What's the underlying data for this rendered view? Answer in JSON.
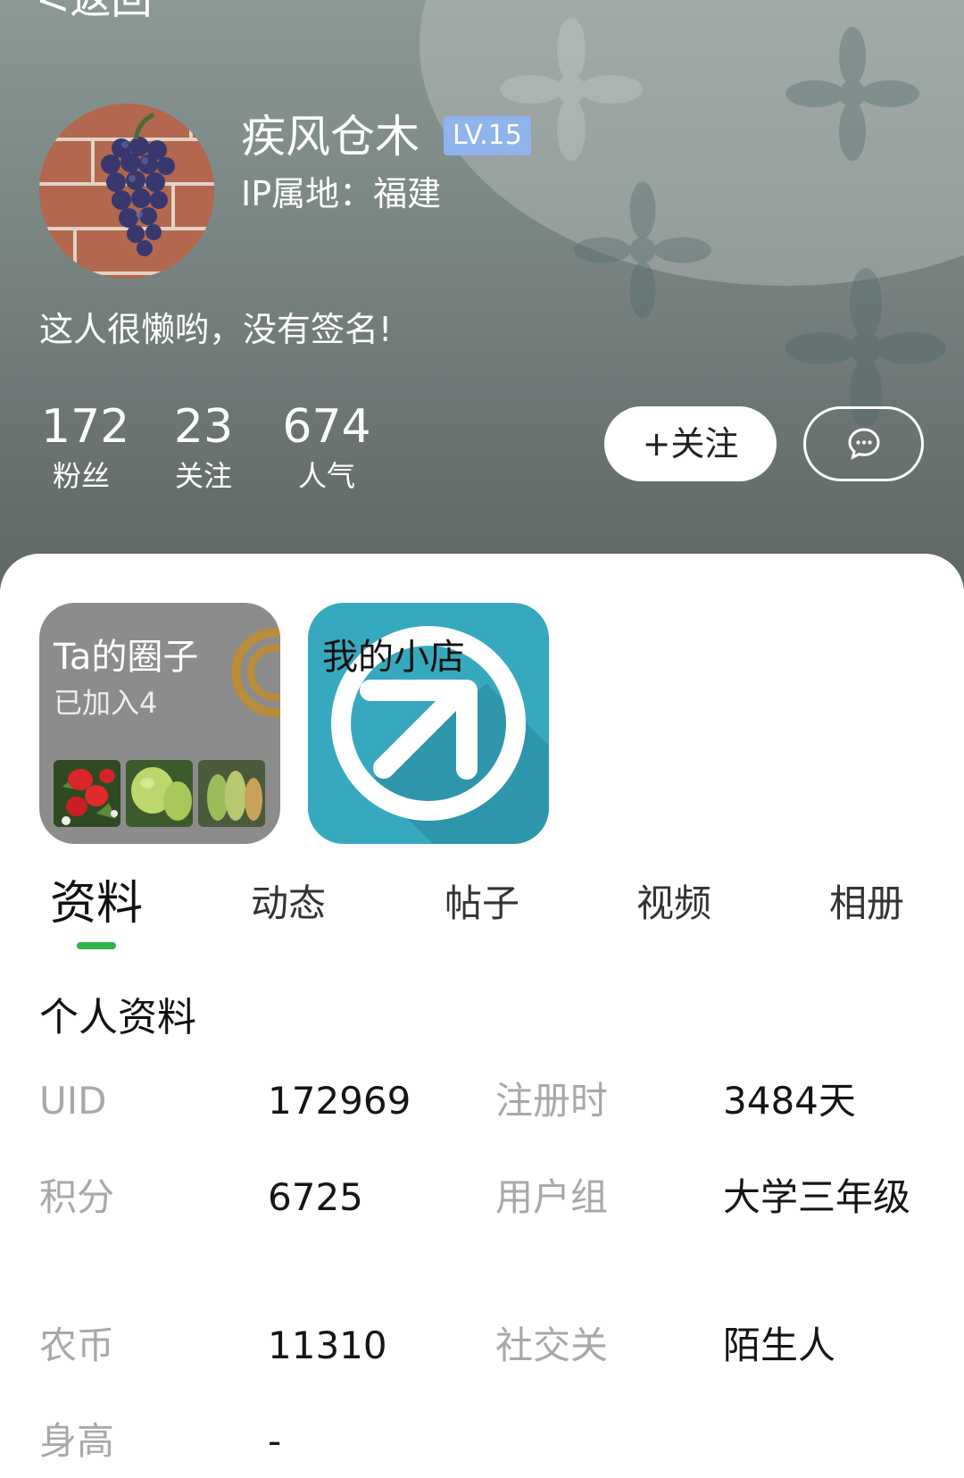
{
  "nav": {
    "back_label": "<返回"
  },
  "profile": {
    "username": "疾风仓木",
    "level": "LV.15",
    "ip_location": "IP属地：福建",
    "signature": "这人很懒哟，没有签名!"
  },
  "stats": [
    {
      "value": "172",
      "label": "粉丝"
    },
    {
      "value": "23",
      "label": "关注"
    },
    {
      "value": "674",
      "label": "人气"
    }
  ],
  "actions": {
    "follow_label": "+关注",
    "message_icon": "chat-bubble-icon"
  },
  "tiles": {
    "circles": {
      "title": "Ta的圈子",
      "subtitle": "已加入4"
    },
    "shop": {
      "title": "我的小店"
    }
  },
  "tabs": [
    {
      "label": "资料",
      "active": true
    },
    {
      "label": "动态",
      "active": false
    },
    {
      "label": "帖子",
      "active": false
    },
    {
      "label": "视频",
      "active": false
    },
    {
      "label": "相册",
      "active": false
    }
  ],
  "info": {
    "section_title": "个人资料",
    "fields": [
      {
        "label": "UID",
        "value": "172969"
      },
      {
        "label": "注册时",
        "value": "3484天"
      },
      {
        "label": "积分",
        "value": "6725"
      },
      {
        "label": "用户组",
        "value": "大学三年级"
      },
      {
        "label": "农币",
        "value": "11310"
      },
      {
        "label": "社交关",
        "value": "陌生人"
      },
      {
        "label": "身高",
        "value": "-"
      }
    ]
  },
  "colors": {
    "accent": "#2fb24c",
    "level_badge": "#8fb4ec",
    "shop_tile": "#37a9bf"
  }
}
